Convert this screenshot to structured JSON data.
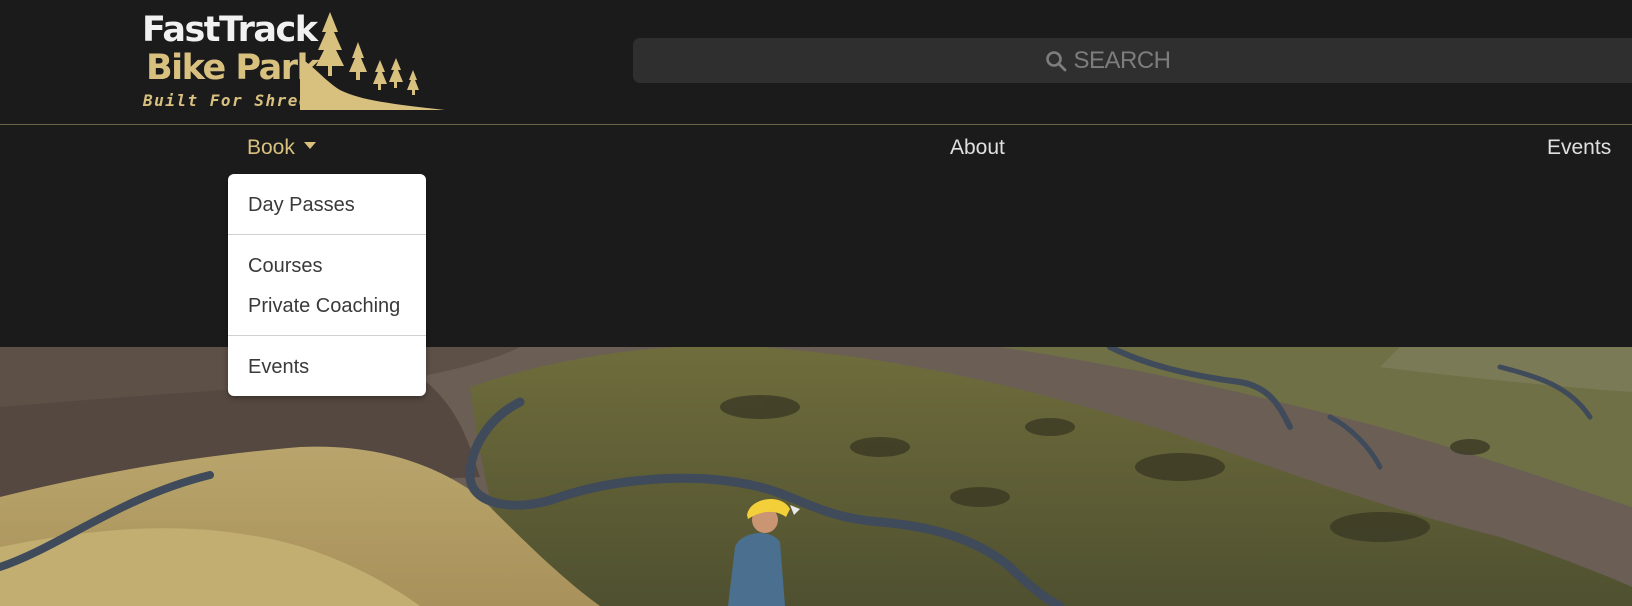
{
  "logo": {
    "line1": "FastTrack",
    "line2": "Bike Park",
    "tagline": "Built For Shredding",
    "brand_color": "#d8c07f"
  },
  "search": {
    "icon": "search-icon",
    "label": "SEARCH"
  },
  "nav": {
    "book": "Book",
    "about": "About",
    "events": "Events"
  },
  "dropdown": {
    "items": [
      "Day Passes",
      "Courses",
      "Private Coaching",
      "Events"
    ]
  },
  "colors": {
    "background": "#1b1b1b",
    "accent": "#d8c07f",
    "search_bg": "#2f2f2f"
  }
}
